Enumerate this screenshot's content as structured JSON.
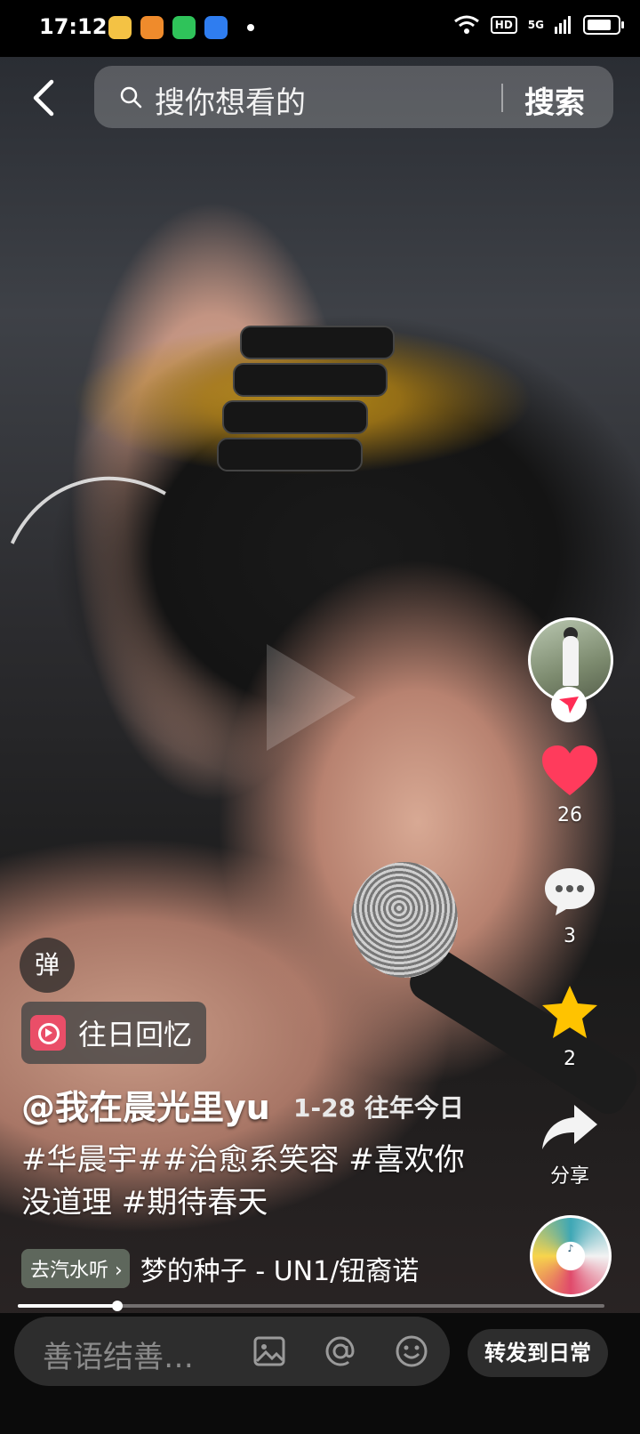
{
  "status_bar": {
    "time": "17:12",
    "hd": "HD",
    "network": "5G",
    "battery_level": 0.85
  },
  "search": {
    "placeholder": "搜你想看的",
    "button": "搜索"
  },
  "actions": {
    "likes": "26",
    "comments": "3",
    "favorites": "2",
    "share": "分享"
  },
  "overlay": {
    "danmu": "弹",
    "memory_tag": "往日回忆",
    "author": "@我在晨光里yu",
    "date_tag": "1-28 往年今日",
    "caption": "#华晨宇##治愈系笑容 #喜欢你没道理 #期待春天",
    "music_chip": "去汽水听",
    "music_name": "梦的种子 - UN1/钮裔诺"
  },
  "playback": {
    "progress": 0.17
  },
  "bottom_bar": {
    "comment_placeholder": "善语结善…",
    "forward_button": "转发到日常"
  },
  "colors": {
    "like_red": "#ff3b5c",
    "favorite_yellow": "#ffc300",
    "memory_icon": "#ea4e68"
  }
}
